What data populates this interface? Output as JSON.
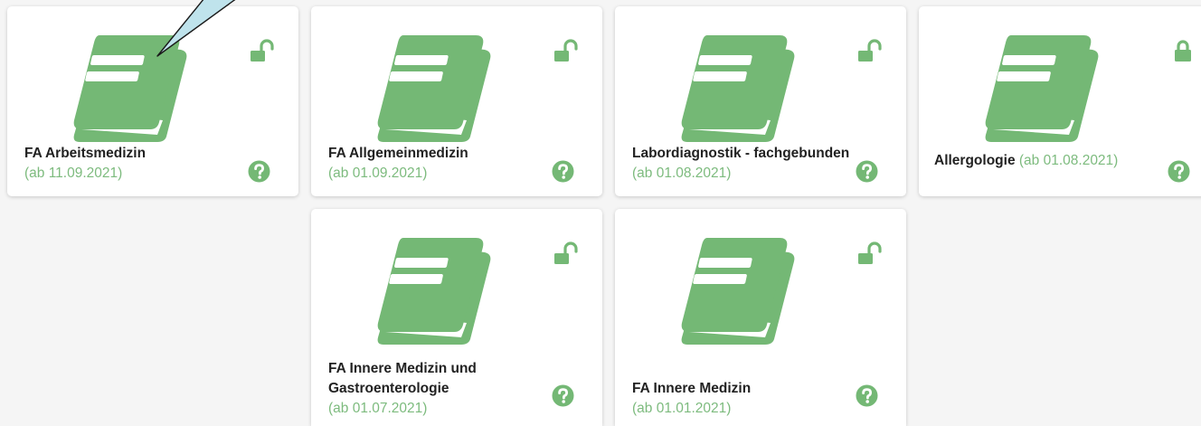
{
  "accent_color": "#74b875",
  "cards": [
    {
      "title": "FA Arbeitsmedizin",
      "date": "(ab 11.09.2021)",
      "lock": "lock-open-icon"
    },
    {
      "title": "FA Allgemeinmedizin",
      "date": "(ab 01.09.2021)",
      "lock": "lock-open-icon"
    },
    {
      "title": "Labordiagnostik - fachgebunden",
      "date": "(ab 01.08.2021)",
      "lock": "lock-open-icon"
    },
    {
      "title": "Allergologie",
      "date": "(ab 01.08.2021)",
      "lock": "lock-closed-icon"
    },
    {
      "title": "FA Innere Medizin und Gastroenterologie",
      "date": "(ab 01.07.2021)",
      "lock": "lock-open-icon"
    },
    {
      "title": "FA Innere Medizin",
      "date": "(ab 01.01.2021)",
      "lock": "lock-open-icon"
    }
  ]
}
